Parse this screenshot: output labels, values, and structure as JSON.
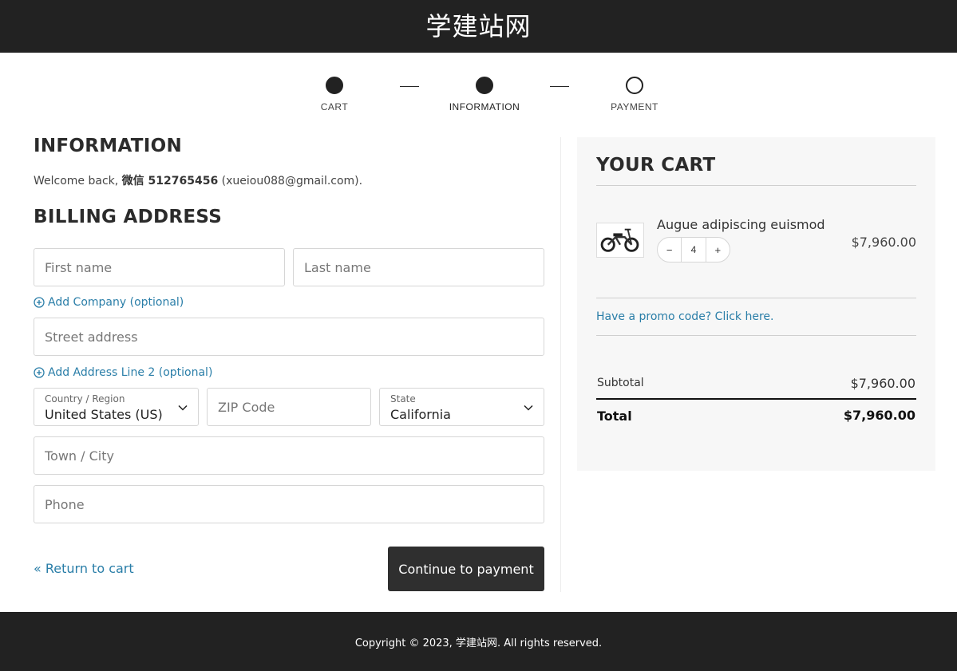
{
  "header": {
    "site_title": "学建站网"
  },
  "steps": [
    {
      "label": "CART",
      "state": "done"
    },
    {
      "label": "INFORMATION",
      "state": "current"
    },
    {
      "label": "PAYMENT",
      "state": "pending"
    }
  ],
  "information": {
    "title": "INFORMATION",
    "welcome_prefix": "Welcome back, ",
    "user_name": "微信 512765456",
    "user_email": " (xueiou088@gmail.com)."
  },
  "billing": {
    "title": "BILLING ADDRESS",
    "first_name_placeholder": "First name",
    "last_name_placeholder": "Last name",
    "add_company": "Add Company (optional)",
    "street_placeholder": "Street address",
    "add_address_line2": "Add Address Line 2 (optional)",
    "country_label": "Country / Region",
    "country_value": "United States (US)",
    "zip_placeholder": "ZIP Code",
    "state_label": "State",
    "state_value": "California",
    "city_placeholder": "Town / City",
    "phone_placeholder": "Phone"
  },
  "actions": {
    "return_to_cart": "« Return to cart",
    "continue": "Continue to payment"
  },
  "cart": {
    "title": "YOUR CART",
    "item": {
      "name": "Augue adipiscing euismod",
      "quantity": "4",
      "decrement": "−",
      "increment": "+",
      "price": "$7,960.00"
    },
    "promo": "Have a promo code? Click here.",
    "subtotal_label": "Subtotal",
    "subtotal_value": "$7,960.00",
    "total_label": "Total",
    "total_value": "$7,960.00"
  },
  "footer": {
    "copyright": "Copyright © 2023, 学建站网. All rights reserved."
  },
  "colors": {
    "dark": "#222222",
    "link": "#2a7ea8",
    "button": "#2f2f2f",
    "cart_bg": "#f7f7f7"
  }
}
